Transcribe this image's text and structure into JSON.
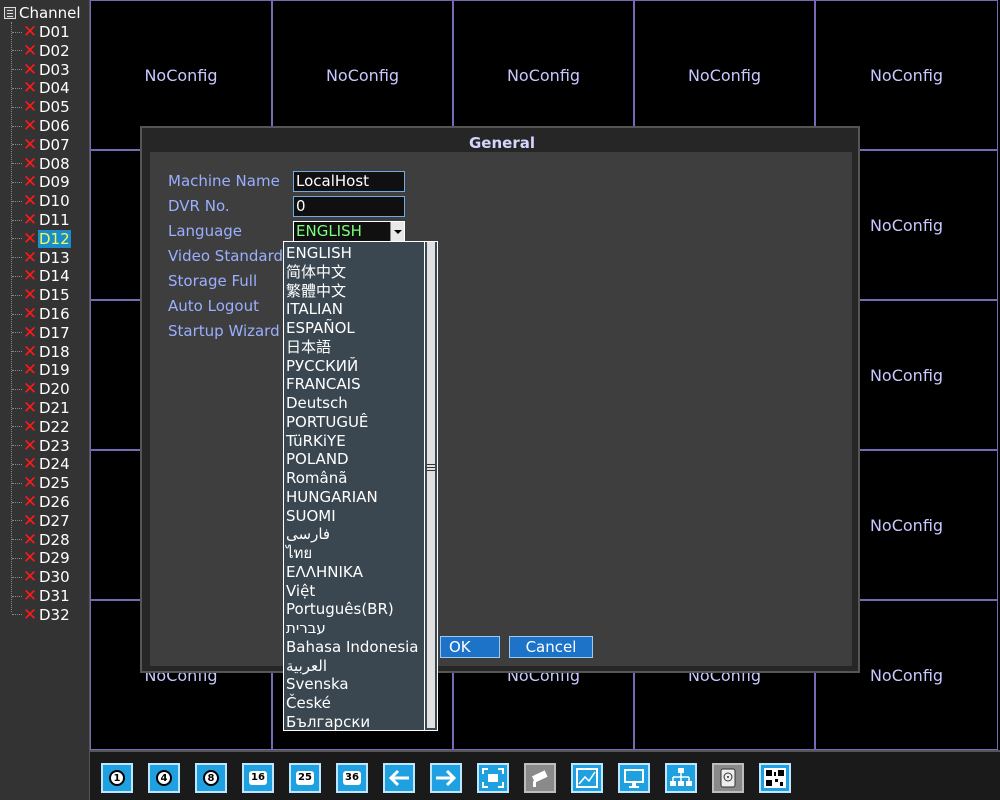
{
  "sidebar": {
    "header": "Channel",
    "selected": "D12",
    "channels": [
      "D01",
      "D02",
      "D03",
      "D04",
      "D05",
      "D06",
      "D07",
      "D08",
      "D09",
      "D10",
      "D11",
      "D12",
      "D13",
      "D14",
      "D15",
      "D16",
      "D17",
      "D18",
      "D19",
      "D20",
      "D21",
      "D22",
      "D23",
      "D24",
      "D25",
      "D26",
      "D27",
      "D28",
      "D29",
      "D30",
      "D31",
      "D32"
    ]
  },
  "grid": {
    "cell_text": "NoConfig"
  },
  "dialog": {
    "title": "General",
    "fields": {
      "machine_name_label": "Machine Name",
      "machine_name_value": "LocalHost",
      "dvr_no_label": "DVR No.",
      "dvr_no_value": "0",
      "language_label": "Language",
      "language_value": "ENGLISH",
      "video_standard_label": "Video Standard",
      "storage_full_label": "Storage Full",
      "auto_logout_label": "Auto Logout",
      "startup_wizard_label": "Startup Wizard"
    },
    "ok_label": "OK",
    "cancel_label": "Cancel"
  },
  "language_options": [
    "ENGLISH",
    "简体中文",
    "繁體中文",
    "ITALIAN",
    "ESPAÑOL",
    "日本語",
    "РУССКИЙ",
    "FRANCAIS",
    "Deutsch",
    "PORTUGUÊ",
    "TüRKiYE",
    "POLAND",
    "Românã",
    "HUNGARIAN",
    "SUOMI",
    "فارسی",
    "ไทย",
    "ΕΛΛΗΝΙΚΑ",
    "Việt",
    "Português(BR)",
    "עברית",
    "Bahasa Indonesia",
    "العربية",
    "Svenska",
    "České",
    "Български"
  ],
  "toolbar": {
    "split_1": "1",
    "split_4": "4",
    "split_8": "8",
    "split_16": "16",
    "split_25": "25",
    "split_36": "36",
    "icons": [
      "prev-icon",
      "next-icon",
      "fullscreen-icon",
      "camera-icon",
      "chart-icon",
      "monitor-icon",
      "network-icon",
      "hdd-icon",
      "qrcode-icon"
    ]
  },
  "colors": {
    "accent": "#1fa0e0",
    "error": "#ff1a1a",
    "grid_border": "#7a68b6",
    "label_text": "#9ab0ff"
  }
}
